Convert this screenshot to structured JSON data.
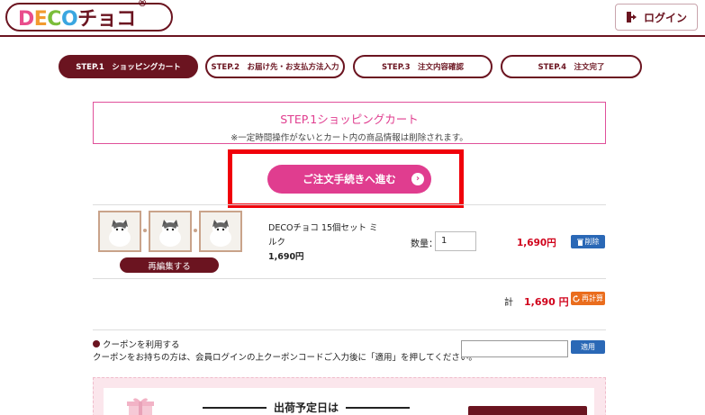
{
  "header": {
    "logo": {
      "letters": [
        {
          "char": "D",
          "color": "#e94d8c"
        },
        {
          "char": "E",
          "color": "#f29a2e"
        },
        {
          "char": "C",
          "color": "#7bbd3a"
        },
        {
          "char": "O",
          "color": "#3aa6e0"
        },
        {
          "char": "チョコ",
          "color": "#6b1420"
        }
      ],
      "reg": "®"
    },
    "login_label": "ログイン",
    "login_icon": "door-icon"
  },
  "steps": [
    {
      "label": "STEP.1　ショッピングカート",
      "active": true
    },
    {
      "label": "STEP.2　お届け先・お支払方法入力",
      "active": false
    },
    {
      "label": "STEP.3　注文内容確認",
      "active": false
    },
    {
      "label": "STEP.4　注文完了",
      "active": false
    }
  ],
  "banner": {
    "title": "STEP.1ショッピングカート",
    "subtitle": "※一定時間操作がないとカート内の商品情報は削除されます。"
  },
  "proceed": {
    "label": "ご注文手続きへ進む",
    "chevron": "›"
  },
  "cart": {
    "item": {
      "name": "DECOチョコ 15個セット ミルク",
      "unit_price": "1,690円",
      "qty_label": "数量：",
      "qty_value": "1",
      "line_price": "1,690円",
      "reedit_label": "再編集する",
      "delete_label": "削除"
    },
    "total_label": "計",
    "total_value": "1,690 円",
    "recalc_label": "再計算"
  },
  "coupon": {
    "title": "クーポンを利用する",
    "desc": "クーポンをお持ちの方は、会員ログインの上クーポンコードご入力後に「適用」を押してください。",
    "input_value": "",
    "apply_label": "適用"
  },
  "shipping": {
    "title": "出荷予定日は"
  },
  "colors": {
    "brand": "#6b1420",
    "accent_pink": "#e03d8f",
    "price_red": "#d0021b",
    "button_blue": "#2a68b6",
    "button_orange": "#ea6d1d",
    "highlight_red": "#f0000a"
  }
}
